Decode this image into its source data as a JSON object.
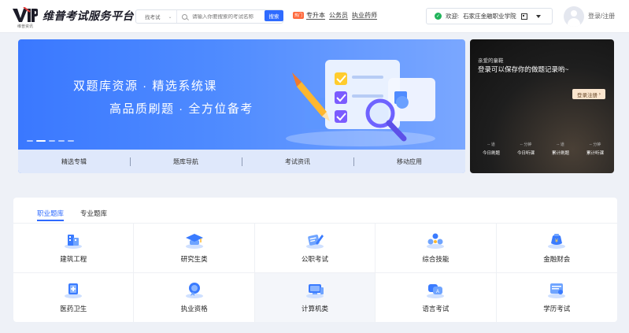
{
  "header": {
    "logo_mark": "VIP",
    "logo_small": "维普资讯",
    "logo_title": "维普考试服务平台",
    "search_select": "找考试",
    "search_placeholder": "请输入你要搜索的考试名称",
    "search_button": "搜索",
    "hot_tag": "热门",
    "nav_links": [
      "专升本",
      "公务员",
      "执业药师"
    ],
    "school_welcome": "欢迎:",
    "school_name": "石家庄金融职业学院",
    "login": "登录/注册"
  },
  "banner": {
    "line1": "双题库资源 · 精选系统课",
    "line2": "高品质刷题 · 全方位备考",
    "nav_items": [
      "精选专辑",
      "题库导航",
      "考试资讯",
      "移动应用"
    ]
  },
  "side_panel": {
    "greeting": "亲爱的童鞋",
    "message": "登录可以保存你的做题记录哟~",
    "button": "登录注册",
    "stats": [
      {
        "value": "-- 道",
        "label": "今日刷题"
      },
      {
        "value": "-- 分钟",
        "label": "今日听课"
      },
      {
        "value": "-- 道",
        "label": "累计刷题"
      },
      {
        "value": "-- 分钟",
        "label": "累计听课"
      }
    ]
  },
  "content": {
    "tabs": [
      "职业题库",
      "专业题库"
    ],
    "categories": [
      {
        "label": "建筑工程",
        "icon": "building-icon"
      },
      {
        "label": "研究生类",
        "icon": "graduation-cap-icon"
      },
      {
        "label": "公职考试",
        "icon": "document-pen-icon"
      },
      {
        "label": "综合技能",
        "icon": "skills-icon"
      },
      {
        "label": "金融财会",
        "icon": "money-bag-icon"
      },
      {
        "label": "医药卫生",
        "icon": "medical-icon"
      },
      {
        "label": "执业资格",
        "icon": "certificate-icon"
      },
      {
        "label": "计算机类",
        "icon": "computer-icon"
      },
      {
        "label": "语言考试",
        "icon": "language-icon"
      },
      {
        "label": "学历考试",
        "icon": "diploma-icon"
      }
    ]
  },
  "colors": {
    "accent": "#2f6bff",
    "banner_start": "#3a78ff",
    "banner_end": "#7aa7ff",
    "side_button": "#fbe6cf",
    "hot_tag": "#ff6a3d",
    "check_green": "#20b35a"
  }
}
